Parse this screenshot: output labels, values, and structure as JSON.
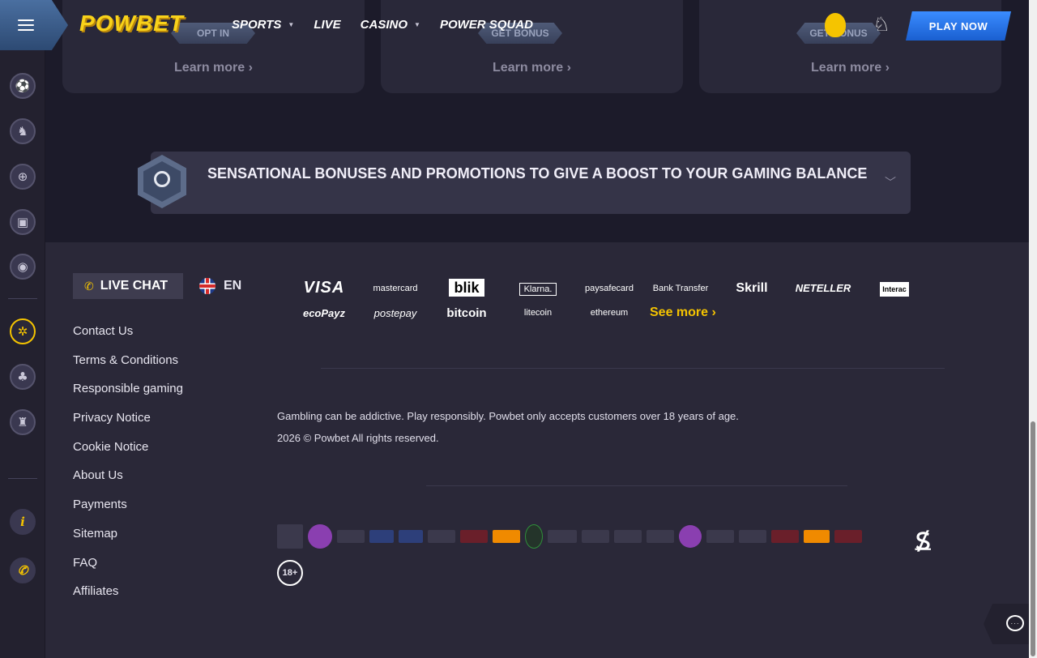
{
  "header": {
    "logo": "POWBET",
    "nav": [
      {
        "label": "SPORTS",
        "dropdown": true
      },
      {
        "label": "LIVE",
        "dropdown": false
      },
      {
        "label": "CASINO",
        "dropdown": true
      },
      {
        "label": "POWER SQUAD",
        "dropdown": false
      }
    ],
    "play_now": "PLAY NOW"
  },
  "cards": [
    {
      "pill": "OPT IN",
      "link": "Learn more ›"
    },
    {
      "pill": "GET BONUS",
      "link": "Learn more ›"
    },
    {
      "pill": "GET BONUS",
      "link": "Learn more ›"
    }
  ],
  "promo": {
    "text": "SENSATIONAL BONUSES AND PROMOTIONS TO GIVE A BOOST TO YOUR GAMING BALANCE"
  },
  "footer": {
    "live_chat": "LIVE CHAT",
    "language": "EN",
    "links": [
      "Contact Us",
      "Terms & Conditions",
      "Responsible gaming",
      "Privacy Notice",
      "Cookie Notice",
      "About Us",
      "Payments",
      "Sitemap",
      "FAQ",
      "Affiliates"
    ],
    "payments_row1": [
      "VISA",
      "mastercard",
      "blik",
      "Klarna.",
      "paysafecard",
      "Bank Transfer",
      "Skrill",
      "NETELLER",
      "Interac"
    ],
    "payments_row2": [
      "ecoPayz",
      "postepay",
      "bitcoin",
      "litecoin",
      "ethereum"
    ],
    "see_more": "See more ›",
    "disclaimer": "Gambling can be addictive. Play responsibly. Powbet only accepts customers over 18 years of age.",
    "copyright": "2026 © Powbet All rights reserved.",
    "age": "18+"
  },
  "colors": {
    "accent": "#f5c400",
    "play_button": "#2b78ee",
    "background": "#2a2838",
    "panel": "#1c1b2a"
  },
  "icons": {
    "sidebar": [
      "soccer-ball-icon",
      "horse-icon",
      "globe-icon",
      "slot-machine-icon",
      "live-signal-icon",
      "wheel-icon",
      "clover-icon",
      "trophy-icon",
      "info-icon",
      "phone-icon"
    ]
  }
}
